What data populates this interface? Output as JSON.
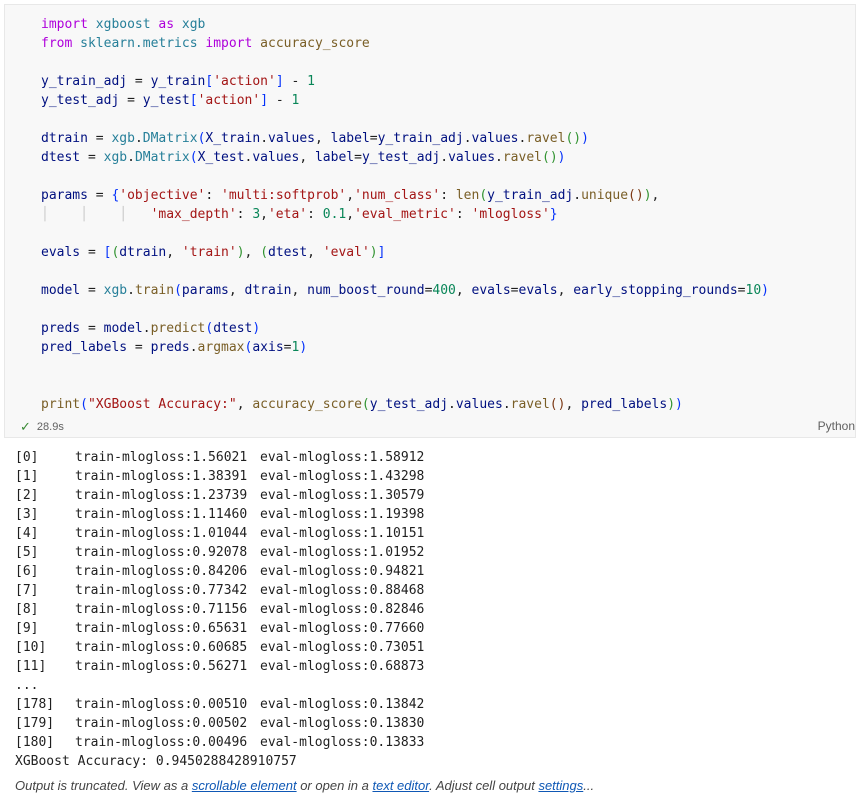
{
  "cell": {
    "code_lines": [
      [
        [
          "kw",
          "import"
        ],
        [
          "op",
          " "
        ],
        [
          "mod",
          "xgboost"
        ],
        [
          "op",
          " "
        ],
        [
          "kw",
          "as"
        ],
        [
          "op",
          " "
        ],
        [
          "mod",
          "xgb"
        ]
      ],
      [
        [
          "kw",
          "from"
        ],
        [
          "op",
          " "
        ],
        [
          "mod",
          "sklearn.metrics"
        ],
        [
          "op",
          " "
        ],
        [
          "kw",
          "import"
        ],
        [
          "op",
          " "
        ],
        [
          "fn",
          "accuracy_score"
        ]
      ],
      [],
      [
        [
          "var",
          "y_train_adj"
        ],
        [
          "op",
          " = "
        ],
        [
          "var",
          "y_train"
        ],
        [
          "br1",
          "["
        ],
        [
          "str",
          "'action'"
        ],
        [
          "br1",
          "]"
        ],
        [
          "op",
          " - "
        ],
        [
          "num",
          "1"
        ]
      ],
      [
        [
          "var",
          "y_test_adj"
        ],
        [
          "op",
          " = "
        ],
        [
          "var",
          "y_test"
        ],
        [
          "br1",
          "["
        ],
        [
          "str",
          "'action'"
        ],
        [
          "br1",
          "]"
        ],
        [
          "op",
          " - "
        ],
        [
          "num",
          "1"
        ]
      ],
      [],
      [
        [
          "var",
          "dtrain"
        ],
        [
          "op",
          " = "
        ],
        [
          "mod",
          "xgb"
        ],
        [
          "op",
          "."
        ],
        [
          "mod",
          "DMatrix"
        ],
        [
          "br1",
          "("
        ],
        [
          "var",
          "X_train"
        ],
        [
          "op",
          "."
        ],
        [
          "var",
          "values"
        ],
        [
          "op",
          ", "
        ],
        [
          "var",
          "label"
        ],
        [
          "op",
          "="
        ],
        [
          "var",
          "y_train_adj"
        ],
        [
          "op",
          "."
        ],
        [
          "var",
          "values"
        ],
        [
          "op",
          "."
        ],
        [
          "fn",
          "ravel"
        ],
        [
          "br2",
          "()"
        ],
        [
          "br1",
          ")"
        ]
      ],
      [
        [
          "var",
          "dtest"
        ],
        [
          "op",
          " = "
        ],
        [
          "mod",
          "xgb"
        ],
        [
          "op",
          "."
        ],
        [
          "mod",
          "DMatrix"
        ],
        [
          "br1",
          "("
        ],
        [
          "var",
          "X_test"
        ],
        [
          "op",
          "."
        ],
        [
          "var",
          "values"
        ],
        [
          "op",
          ", "
        ],
        [
          "var",
          "label"
        ],
        [
          "op",
          "="
        ],
        [
          "var",
          "y_test_adj"
        ],
        [
          "op",
          "."
        ],
        [
          "var",
          "values"
        ],
        [
          "op",
          "."
        ],
        [
          "fn",
          "ravel"
        ],
        [
          "br2",
          "()"
        ],
        [
          "br1",
          ")"
        ]
      ],
      [],
      [
        [
          "var",
          "params"
        ],
        [
          "op",
          " = "
        ],
        [
          "br1",
          "{"
        ],
        [
          "str",
          "'objective'"
        ],
        [
          "op",
          ": "
        ],
        [
          "str",
          "'multi:softprob'"
        ],
        [
          "op",
          ","
        ],
        [
          "str",
          "'num_class'"
        ],
        [
          "op",
          ": "
        ],
        [
          "fn",
          "len"
        ],
        [
          "br2",
          "("
        ],
        [
          "var",
          "y_train_adj"
        ],
        [
          "op",
          "."
        ],
        [
          "fn",
          "unique"
        ],
        [
          "br3",
          "()"
        ],
        [
          "br2",
          ")"
        ],
        [
          "op",
          ","
        ]
      ],
      [
        [
          "guide",
          "│    │    │   "
        ],
        [
          "str",
          "'max_depth'"
        ],
        [
          "op",
          ": "
        ],
        [
          "num",
          "3"
        ],
        [
          "op",
          ","
        ],
        [
          "str",
          "'eta'"
        ],
        [
          "op",
          ": "
        ],
        [
          "num",
          "0.1"
        ],
        [
          "op",
          ","
        ],
        [
          "str",
          "'eval_metric'"
        ],
        [
          "op",
          ": "
        ],
        [
          "str",
          "'mlogloss'"
        ],
        [
          "br1",
          "}"
        ]
      ],
      [],
      [
        [
          "var",
          "evals"
        ],
        [
          "op",
          " = "
        ],
        [
          "br1",
          "["
        ],
        [
          "br2",
          "("
        ],
        [
          "var",
          "dtrain"
        ],
        [
          "op",
          ", "
        ],
        [
          "str",
          "'train'"
        ],
        [
          "br2",
          ")"
        ],
        [
          "op",
          ", "
        ],
        [
          "br2",
          "("
        ],
        [
          "var",
          "dtest"
        ],
        [
          "op",
          ", "
        ],
        [
          "str",
          "'eval'"
        ],
        [
          "br2",
          ")"
        ],
        [
          "br1",
          "]"
        ]
      ],
      [],
      [
        [
          "var",
          "model"
        ],
        [
          "op",
          " = "
        ],
        [
          "mod",
          "xgb"
        ],
        [
          "op",
          "."
        ],
        [
          "fn",
          "train"
        ],
        [
          "br1",
          "("
        ],
        [
          "var",
          "params"
        ],
        [
          "op",
          ", "
        ],
        [
          "var",
          "dtrain"
        ],
        [
          "op",
          ", "
        ],
        [
          "var",
          "num_boost_round"
        ],
        [
          "op",
          "="
        ],
        [
          "num",
          "400"
        ],
        [
          "op",
          ", "
        ],
        [
          "var",
          "evals"
        ],
        [
          "op",
          "="
        ],
        [
          "var",
          "evals"
        ],
        [
          "op",
          ", "
        ],
        [
          "var",
          "early_stopping_rounds"
        ],
        [
          "op",
          "="
        ],
        [
          "num",
          "10"
        ],
        [
          "br1",
          ")"
        ]
      ],
      [],
      [
        [
          "var",
          "preds"
        ],
        [
          "op",
          " = "
        ],
        [
          "var",
          "model"
        ],
        [
          "op",
          "."
        ],
        [
          "fn",
          "predict"
        ],
        [
          "br1",
          "("
        ],
        [
          "var",
          "dtest"
        ],
        [
          "br1",
          ")"
        ]
      ],
      [
        [
          "var",
          "pred_labels"
        ],
        [
          "op",
          " = "
        ],
        [
          "var",
          "preds"
        ],
        [
          "op",
          "."
        ],
        [
          "fn",
          "argmax"
        ],
        [
          "br1",
          "("
        ],
        [
          "var",
          "axis"
        ],
        [
          "op",
          "="
        ],
        [
          "num",
          "1"
        ],
        [
          "br1",
          ")"
        ]
      ],
      [],
      [],
      [
        [
          "fn",
          "print"
        ],
        [
          "br1",
          "("
        ],
        [
          "str",
          "\"XGBoost Accuracy:\""
        ],
        [
          "op",
          ", "
        ],
        [
          "fn",
          "accuracy_score"
        ],
        [
          "br2",
          "("
        ],
        [
          "var",
          "y_test_adj"
        ],
        [
          "op",
          "."
        ],
        [
          "var",
          "values"
        ],
        [
          "op",
          "."
        ],
        [
          "fn",
          "ravel"
        ],
        [
          "br3",
          "()"
        ],
        [
          "op",
          ", "
        ],
        [
          "var",
          "pred_labels"
        ],
        [
          "br2",
          ")"
        ],
        [
          "br1",
          ")"
        ]
      ]
    ],
    "check_icon": "✓",
    "exec_time": "28.9s",
    "language": "Python"
  },
  "output": {
    "rows": [
      [
        "[0]",
        "train-mlogloss:1.56021",
        "eval-mlogloss:1.58912"
      ],
      [
        "[1]",
        "train-mlogloss:1.38391",
        "eval-mlogloss:1.43298"
      ],
      [
        "[2]",
        "train-mlogloss:1.23739",
        "eval-mlogloss:1.30579"
      ],
      [
        "[3]",
        "train-mlogloss:1.11460",
        "eval-mlogloss:1.19398"
      ],
      [
        "[4]",
        "train-mlogloss:1.01044",
        "eval-mlogloss:1.10151"
      ],
      [
        "[5]",
        "train-mlogloss:0.92078",
        "eval-mlogloss:1.01952"
      ],
      [
        "[6]",
        "train-mlogloss:0.84206",
        "eval-mlogloss:0.94821"
      ],
      [
        "[7]",
        "train-mlogloss:0.77342",
        "eval-mlogloss:0.88468"
      ],
      [
        "[8]",
        "train-mlogloss:0.71156",
        "eval-mlogloss:0.82846"
      ],
      [
        "[9]",
        "train-mlogloss:0.65631",
        "eval-mlogloss:0.77660"
      ],
      [
        "[10]",
        "train-mlogloss:0.60685",
        "eval-mlogloss:0.73051"
      ],
      [
        "[11]",
        "train-mlogloss:0.56271",
        "eval-mlogloss:0.68873"
      ],
      [
        "...",
        "",
        ""
      ],
      [
        "[178]",
        "train-mlogloss:0.00510",
        "eval-mlogloss:0.13842"
      ],
      [
        "[179]",
        "train-mlogloss:0.00502",
        "eval-mlogloss:0.13830"
      ],
      [
        "[180]",
        "train-mlogloss:0.00496",
        "eval-mlogloss:0.13833"
      ]
    ],
    "accuracy_line": "XGBoost Accuracy: 0.9450288428910757"
  },
  "truncation": {
    "prefix": "Output is truncated. View as a ",
    "link_scrollable": "scrollable element",
    "middle": " or open in a ",
    "link_editor": "text editor",
    "middle2": ". Adjust cell output ",
    "link_settings": "settings",
    "suffix": "..."
  }
}
